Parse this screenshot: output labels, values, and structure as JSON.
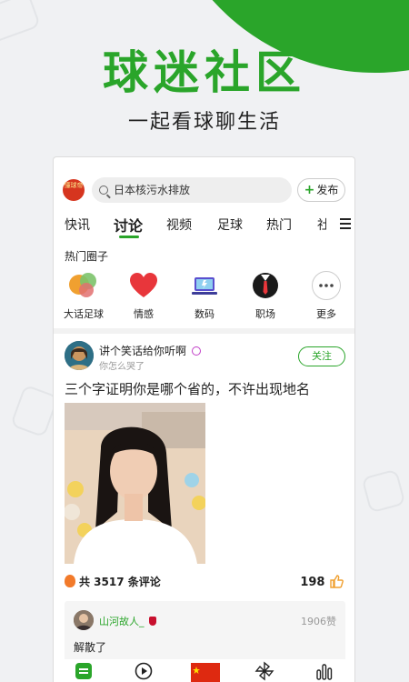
{
  "hero": {
    "title": "球迷社区",
    "subtitle": "一起看球聊生活"
  },
  "app": {
    "logo_text": "懂球帝",
    "search": {
      "text": "日本核污水排放"
    },
    "post_button": {
      "plus": "+",
      "label": "发布"
    },
    "tabs": [
      {
        "label": "快讯",
        "active": false
      },
      {
        "label": "讨论",
        "active": true
      },
      {
        "label": "视频",
        "active": false
      },
      {
        "label": "足球",
        "active": false
      },
      {
        "label": "热门",
        "active": false
      },
      {
        "label": "社",
        "active": false
      }
    ],
    "hot_circles": {
      "title": "热门圈子",
      "items": [
        {
          "label": "大话足球",
          "icon": "chat-bubbles-icon"
        },
        {
          "label": "情感",
          "icon": "heart-icon"
        },
        {
          "label": "数码",
          "icon": "laptop-icon"
        },
        {
          "label": "职场",
          "icon": "suit-icon"
        },
        {
          "label": "更多",
          "icon": "more-icon"
        }
      ]
    },
    "post": {
      "author": "讲个笑话给你听啊",
      "author_sub": "你怎么哭了",
      "follow_label": "关注",
      "title": "三个字证明你是哪个省的，不许出现地名",
      "comments_text": "共 3517 条评论",
      "likes": "198",
      "top_reply": {
        "name": "山河故人_",
        "likes": "1906赞",
        "text": "解散了"
      }
    },
    "bottom_nav": [
      {
        "icon": "home-icon"
      },
      {
        "icon": "play-icon"
      },
      {
        "icon": "flag-icon"
      },
      {
        "icon": "pinwheel-icon"
      },
      {
        "icon": "stats-icon"
      }
    ]
  },
  "colors": {
    "brand_green": "#2aa52a",
    "heart_red": "#e8363b"
  }
}
